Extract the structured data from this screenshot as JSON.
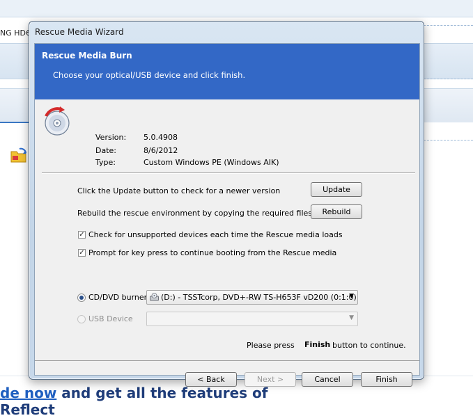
{
  "background": {
    "tab_text": "NG  HD6",
    "upgrade_link": "de now",
    "upgrade_rest": " and get all the features of",
    "upgrade_line2": "Reflect"
  },
  "window": {
    "title": "Rescue Media Wizard"
  },
  "banner": {
    "heading": "Rescue Media Burn",
    "subheading": "Choose your optical/USB device and click finish."
  },
  "info": {
    "version_label": "Version:",
    "version_value": "5.0.4908",
    "date_label": "Date:",
    "date_value": "8/6/2012",
    "type_label": "Type:",
    "type_value": "Custom Windows PE (Windows AIK)"
  },
  "actions": {
    "update_text": "Click the Update button to check for a newer version",
    "update_button": "Update",
    "rebuild_text": "Rebuild the rescue environment by copying the required files",
    "rebuild_button": "Rebuild"
  },
  "options": {
    "check_unsupported": "Check for unsupported devices each time the Rescue media loads",
    "check_unsupported_checked": true,
    "prompt_keypress": "Prompt for key press to continue booting from the Rescue media",
    "prompt_keypress_checked": true
  },
  "device": {
    "cd_label": "CD/DVD burner",
    "cd_selected": true,
    "cd_value": "(D:) - TSSTcorp, DVD+-RW TS-H653F vD200 (0:1:0)",
    "usb_label": "USB Device",
    "usb_selected": false,
    "usb_value": ""
  },
  "instruction": {
    "prefix": "Please press",
    "emphasis": "Finish",
    "suffix": "button to continue."
  },
  "buttons": {
    "back": "< Back",
    "next": "Next >",
    "cancel": "Cancel",
    "finish": "Finish"
  },
  "icons": {
    "cd_icon": "cd-disc-with-red-arrow",
    "drive_icon": "optical-drive-icon",
    "dropdown_icon": "triangle-down",
    "background_icon": "folder-refresh-icon"
  },
  "colors": {
    "banner": "#3368c6",
    "window_frame": "#c3d5e8",
    "link": "#1f5fc0",
    "upgrade_text": "#1f3d7a"
  }
}
